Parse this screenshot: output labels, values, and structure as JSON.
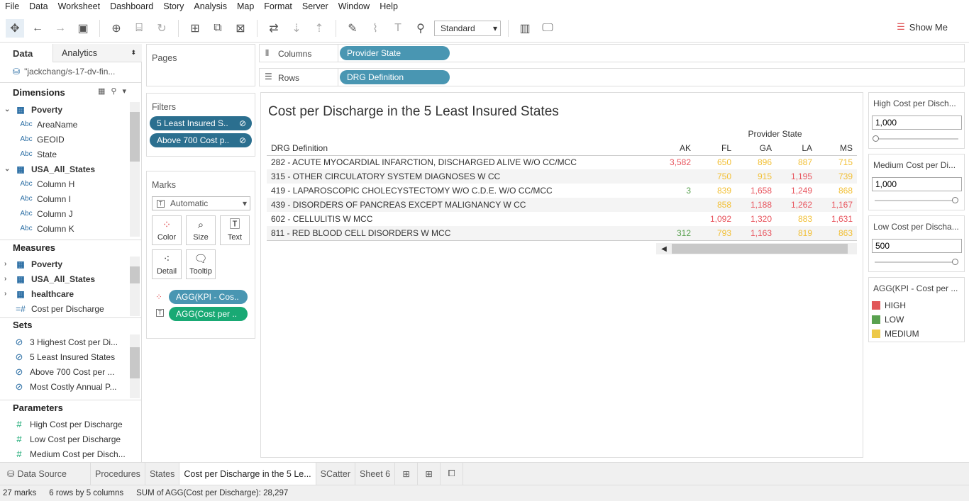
{
  "menu": [
    "File",
    "Data",
    "Worksheet",
    "Dashboard",
    "Story",
    "Analysis",
    "Map",
    "Format",
    "Server",
    "Window",
    "Help"
  ],
  "toolbar": {
    "fit": "Standard",
    "show_me": "Show Me"
  },
  "left": {
    "tab_data": "Data",
    "tab_analytics": "Analytics",
    "datasource": "\"jackchang/s-17-dv-fin...",
    "dimensions_title": "Dimensions",
    "dimensions": [
      {
        "label": "Poverty",
        "type": "table"
      },
      {
        "label": "AreaName",
        "type": "Abc"
      },
      {
        "label": "GEOID",
        "type": "Abc"
      },
      {
        "label": "State",
        "type": "Abc"
      },
      {
        "label": "USA_All_States",
        "type": "table"
      },
      {
        "label": "Column H",
        "type": "Abc"
      },
      {
        "label": "Column I",
        "type": "Abc"
      },
      {
        "label": "Column J",
        "type": "Abc"
      },
      {
        "label": "Column K",
        "type": "Abc"
      }
    ],
    "measures_title": "Measures",
    "measures": [
      {
        "label": "Poverty"
      },
      {
        "label": "USA_All_States"
      },
      {
        "label": "healthcare"
      },
      {
        "label": "Cost per Discharge"
      }
    ],
    "sets_title": "Sets",
    "sets": [
      "3 Highest Cost per Di...",
      "5 Least Insured States",
      "Above 700 Cost per ...",
      "Most Costly Annual P..."
    ],
    "parameters_title": "Parameters",
    "parameters": [
      "High Cost per Discharge",
      "Low Cost per Discharge",
      "Medium Cost per Disch..."
    ],
    "abc": "Abc"
  },
  "shelves": {
    "pages": "Pages",
    "filters": "Filters",
    "filter_pills": [
      "5 Least Insured S..",
      "Above 700 Cost p.."
    ],
    "marks": "Marks",
    "mark_type": "Automatic",
    "mark_buttons": [
      "Color",
      "Size",
      "Text",
      "Detail",
      "Tooltip"
    ],
    "mark_pills": [
      "AGG(KPI - Cos..",
      "AGG(Cost per .."
    ],
    "columns": "Columns",
    "columns_pill": "Provider State",
    "rows": "Rows",
    "rows_pill": "DRG Definition"
  },
  "view": {
    "title": "Cost per Discharge in the 5 Least Insured States",
    "col_group": "Provider State",
    "row_header": "DRG Definition",
    "states": [
      "AK",
      "FL",
      "GA",
      "LA",
      "MS"
    ],
    "rows": [
      {
        "label": "282 - ACUTE MYOCARDIAL INFARCTION, DISCHARGED ALIVE W/O CC/MCC",
        "values": [
          [
            "3,582",
            "HIGH"
          ],
          [
            "650",
            "MEDIUM"
          ],
          [
            "896",
            "MEDIUM"
          ],
          [
            "887",
            "MEDIUM"
          ],
          [
            "715",
            "MEDIUM"
          ]
        ]
      },
      {
        "label": "315 - OTHER CIRCULATORY SYSTEM DIAGNOSES W CC",
        "values": [
          [
            "",
            ""
          ],
          [
            "750",
            "MEDIUM"
          ],
          [
            "915",
            "MEDIUM"
          ],
          [
            "1,195",
            "HIGH"
          ],
          [
            "739",
            "MEDIUM"
          ]
        ]
      },
      {
        "label": "419 - LAPAROSCOPIC CHOLECYSTECTOMY W/O C.D.E. W/O CC/MCC",
        "values": [
          [
            "3",
            "LOW"
          ],
          [
            "839",
            "MEDIUM"
          ],
          [
            "1,658",
            "HIGH"
          ],
          [
            "1,249",
            "HIGH"
          ],
          [
            "868",
            "MEDIUM"
          ]
        ]
      },
      {
        "label": "439 - DISORDERS OF PANCREAS EXCEPT MALIGNANCY W CC",
        "values": [
          [
            "",
            ""
          ],
          [
            "858",
            "MEDIUM"
          ],
          [
            "1,188",
            "HIGH"
          ],
          [
            "1,262",
            "HIGH"
          ],
          [
            "1,167",
            "HIGH"
          ]
        ]
      },
      {
        "label": "602 - CELLULITIS W MCC",
        "values": [
          [
            "",
            ""
          ],
          [
            "1,092",
            "HIGH"
          ],
          [
            "1,320",
            "HIGH"
          ],
          [
            "883",
            "MEDIUM"
          ],
          [
            "1,631",
            "HIGH"
          ]
        ]
      },
      {
        "label": "811 - RED BLOOD CELL DISORDERS W MCC",
        "values": [
          [
            "312",
            "LOW"
          ],
          [
            "793",
            "MEDIUM"
          ],
          [
            "1,163",
            "HIGH"
          ],
          [
            "819",
            "MEDIUM"
          ],
          [
            "863",
            "MEDIUM"
          ]
        ]
      }
    ]
  },
  "colors": {
    "HIGH": "#e8555e",
    "LOW": "#59a14f",
    "MEDIUM": "#f2c037"
  },
  "right": {
    "high": {
      "title": "High Cost per Disch...",
      "value": "1,000",
      "level": 0
    },
    "medium": {
      "title": "Medium Cost per Di...",
      "value": "1,000",
      "level": 1
    },
    "low": {
      "title": "Low Cost per Discha...",
      "value": "500",
      "level": 1
    },
    "legend_title": "AGG(KPI - Cost per ...",
    "legend": [
      {
        "label": "HIGH",
        "color": "#e15759"
      },
      {
        "label": "LOW",
        "color": "#59a14f"
      },
      {
        "label": "MEDIUM",
        "color": "#edc948"
      }
    ]
  },
  "tabs": [
    "Data Source",
    "Procedures",
    "States",
    "Cost per Discharge in the 5 Le...",
    "SCatter",
    "Sheet 6"
  ],
  "status": {
    "marks": "27 marks",
    "dims": "6 rows by 5 columns",
    "sum": "SUM of AGG(Cost per Discharge): 28,297"
  }
}
